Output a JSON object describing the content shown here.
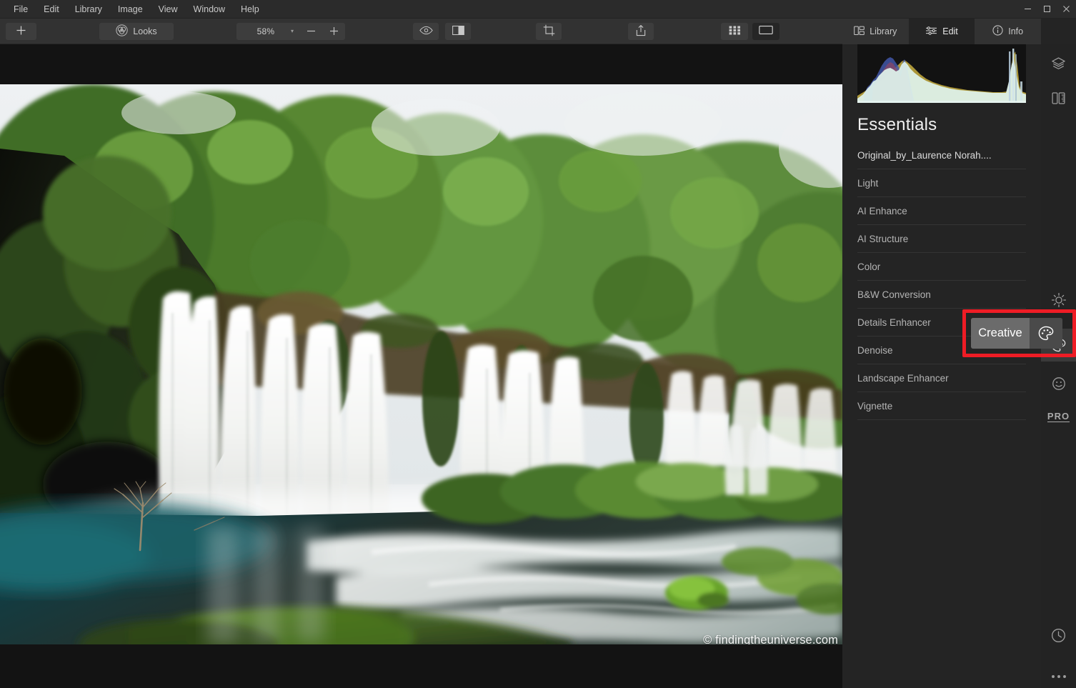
{
  "window": {
    "menu": [
      "File",
      "Edit",
      "Library",
      "Image",
      "View",
      "Window",
      "Help"
    ],
    "controls": {
      "minimize": "minimize-icon",
      "maximize": "maximize-icon",
      "close": "close-icon"
    }
  },
  "toolbar": {
    "add_label": "add-icon",
    "looks_label": "Looks",
    "looks_icon": "looks-venn-icon",
    "zoom_value": "58%",
    "zoom_caret": "▾",
    "zoom_out_label": "−",
    "zoom_in_label": "+",
    "eye_icon": "eye-icon",
    "compare_icon": "before-after-compare-icon",
    "crop_icon": "crop-icon",
    "export_icon": "share-export-icon",
    "grid_icon": "grid-view-icon",
    "single_icon": "single-view-icon"
  },
  "right_panel": {
    "tabs": [
      {
        "label": "Library",
        "icon": "library-icon",
        "active": false
      },
      {
        "label": "Edit",
        "icon": "sliders-icon",
        "active": true
      },
      {
        "label": "Info",
        "icon": "info-icon",
        "active": false
      }
    ],
    "title": "Essentials",
    "filename": "Original_by_Laurence Norah....",
    "tools": [
      "Light",
      "AI Enhance",
      "AI Structure",
      "Color",
      "B&W Conversion",
      "Details Enhancer",
      "Denoise",
      "Landscape Enhancer",
      "Vignette"
    ]
  },
  "rail": {
    "items": [
      {
        "name": "layers-icon",
        "selected": false
      },
      {
        "name": "masking-icon",
        "selected": false
      },
      {
        "name": "sun-brightness-icon",
        "selected": false
      },
      {
        "name": "palette-creative-icon",
        "selected": true
      },
      {
        "name": "portrait-face-icon",
        "selected": false
      },
      {
        "name": "pro-icon",
        "label": "PRO",
        "selected": false
      },
      {
        "name": "history-clock-icon",
        "selected": false
      },
      {
        "name": "more-options-icon",
        "selected": false
      }
    ]
  },
  "tooltip": {
    "label": "Creative",
    "icon": "palette-icon",
    "highlight_color": "#ee1c25"
  },
  "photo": {
    "watermark": "© findingtheuniverse.com",
    "subject": "long-exposure waterfall with green forest and teal pool"
  },
  "colors": {
    "titlebar_bg": "#2b2b2b",
    "toolbar_bg": "#323232",
    "panel_bg": "#242424",
    "canvas_bg": "#131313",
    "accent_red": "#ee1c25",
    "text_primary": "#f0f0f0",
    "text_secondary": "#b4b4b4"
  }
}
